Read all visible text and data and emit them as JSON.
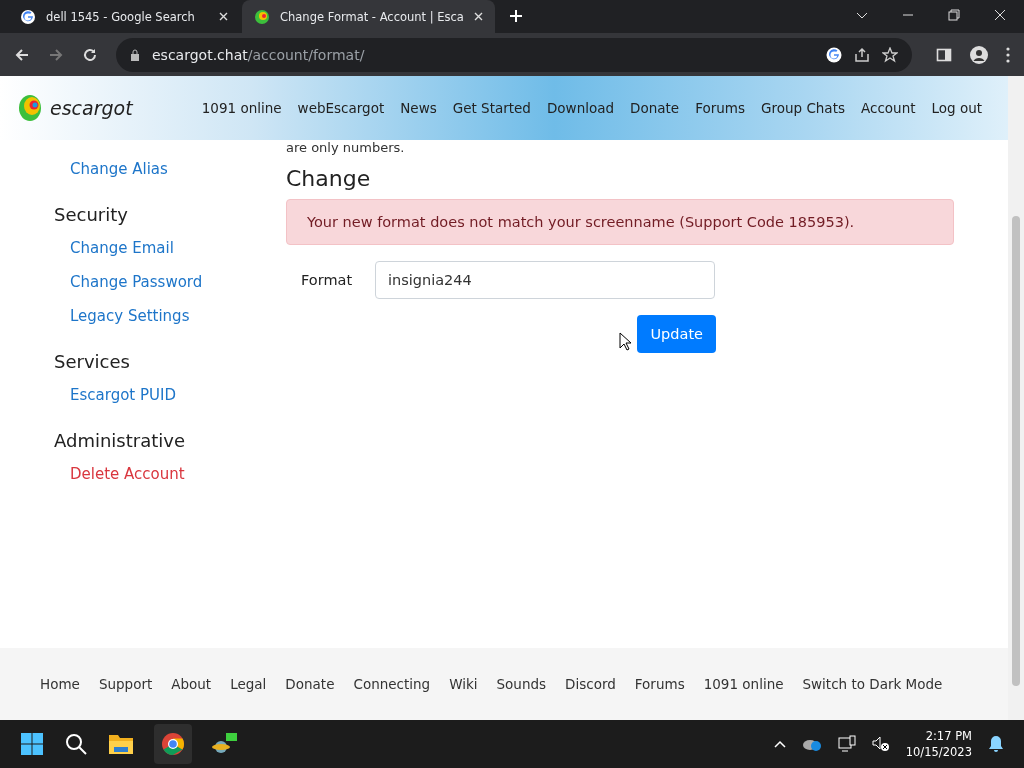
{
  "browser": {
    "tabs": [
      {
        "title": "dell 1545 - Google Search",
        "selected": false
      },
      {
        "title": "Change Format - Account | Esca",
        "selected": true
      }
    ],
    "url": {
      "host": "escargot.chat",
      "path": "/account/format/"
    }
  },
  "header": {
    "logo": "escargot",
    "nav": [
      "1091 online",
      "webEscargot",
      "News",
      "Get Started",
      "Download",
      "Donate",
      "Forums",
      "Group Chats",
      "Account",
      "Log out"
    ]
  },
  "sidebar": [
    {
      "links": [
        {
          "label": "Change Alias",
          "danger": false
        }
      ]
    },
    {
      "heading": "Security",
      "links": [
        {
          "label": "Change Email",
          "danger": false
        },
        {
          "label": "Change Password",
          "danger": false
        },
        {
          "label": "Legacy Settings",
          "danger": false
        }
      ]
    },
    {
      "heading": "Services",
      "links": [
        {
          "label": "Escargot PUID",
          "danger": false
        }
      ]
    },
    {
      "heading": "Administrative",
      "links": [
        {
          "label": "Delete Account",
          "danger": true
        }
      ]
    }
  ],
  "main": {
    "intro_tail": "are only numbers.",
    "heading": "Change",
    "alert": "Your new format does not match your screenname (Support Code 185953).",
    "field_label": "Format",
    "field_value": "insignia244",
    "button": "Update"
  },
  "footer": [
    "Home",
    "Support",
    "About",
    "Legal",
    "Donate",
    "Connecting",
    "Wiki",
    "Sounds",
    "Discord",
    "Forums",
    "1091 online",
    "Switch to Dark Mode"
  ],
  "taskbar": {
    "time": "2:17 PM",
    "date": "10/15/2023"
  }
}
